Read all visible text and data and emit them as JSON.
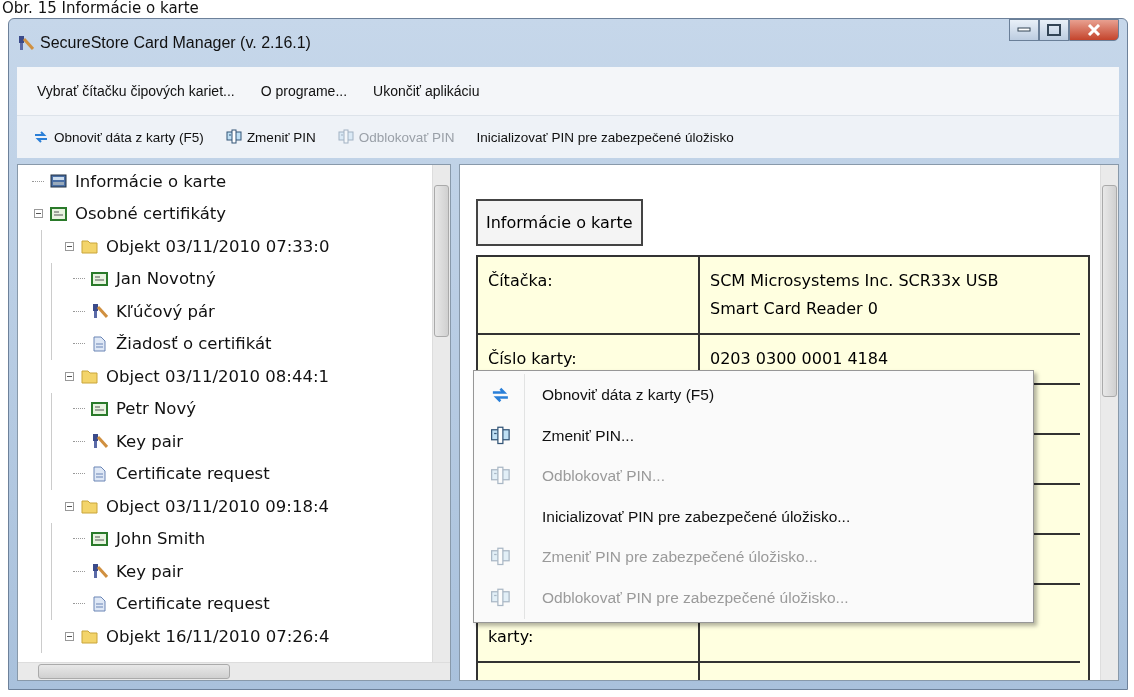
{
  "caption": "Obr. 15 Informácie o karte",
  "window": {
    "title": "SecureStore Card Manager (v. 2.16.1)"
  },
  "menu_bar": [
    "Vybrať čítačku čipových kariet...",
    "O programe...",
    "Ukončiť aplikáciu"
  ],
  "toolbar": [
    {
      "label": "Obnoviť dáta z karty (F5)",
      "kind": "refresh",
      "disabled": false
    },
    {
      "label": "Zmeniť PIN",
      "kind": "pin",
      "disabled": false
    },
    {
      "label": "Odblokovať PIN",
      "kind": "pin",
      "disabled": true
    },
    {
      "label": "Inicializovať PIN pre zabezpečené úložisko",
      "kind": "plain",
      "disabled": false
    }
  ],
  "tree": [
    {
      "label": "Informácie o karte",
      "kind": "info",
      "selected": false
    },
    {
      "label": "Osobné certifikáty",
      "kind": "cert",
      "expanded": true,
      "children": [
        {
          "label": "Objekt 03/11/2010 07:33:0",
          "kind": "folder",
          "expanded": true,
          "children": [
            {
              "label": "Jan Novotný",
              "kind": "cert"
            },
            {
              "label": "Kľúčový pár",
              "kind": "key"
            },
            {
              "label": "Žiadosť o certifikát",
              "kind": "doc"
            }
          ]
        },
        {
          "label": "Object 03/11/2010 08:44:1",
          "kind": "folder",
          "expanded": true,
          "children": [
            {
              "label": "Petr Nový",
              "kind": "cert"
            },
            {
              "label": "Key pair",
              "kind": "key"
            },
            {
              "label": "Certificate request",
              "kind": "doc"
            }
          ]
        },
        {
          "label": "Object 03/11/2010 09:18:4",
          "kind": "folder",
          "expanded": true,
          "children": [
            {
              "label": "John Smith",
              "kind": "cert"
            },
            {
              "label": "Key pair",
              "kind": "key"
            },
            {
              "label": "Certificate request",
              "kind": "doc"
            }
          ]
        },
        {
          "label": "Objekt 16/11/2010 07:26:4",
          "kind": "folder",
          "expanded": true
        }
      ]
    }
  ],
  "detail": {
    "heading": "Informácie o karte",
    "rows": [
      {
        "label": "Čítačka:",
        "value": "SCM Microsystems Inc. SCR33x USB Smart Card Reader 0"
      },
      {
        "label": "Číslo karty:",
        "value": "0203 0300 0001 4184"
      },
      {},
      {},
      {},
      {},
      {
        "label": "karty:"
      },
      {}
    ]
  },
  "context_menu": [
    {
      "label": "Obnoviť dáta z karty (F5)",
      "kind": "refresh",
      "disabled": false
    },
    {
      "label": "Zmeniť PIN...",
      "kind": "pin",
      "disabled": false
    },
    {
      "label": "Odblokovať PIN...",
      "kind": "pin",
      "disabled": true
    },
    {
      "label": "Inicializovať PIN pre zabezpečené úložisko...",
      "kind": "plain",
      "disabled": false
    },
    {
      "label": "Zmeniť PIN pre zabezpečené úložisko...",
      "kind": "pin",
      "disabled": true
    },
    {
      "label": "Odblokovať PIN pre zabezpečené úložisko...",
      "kind": "pin",
      "disabled": true
    }
  ]
}
